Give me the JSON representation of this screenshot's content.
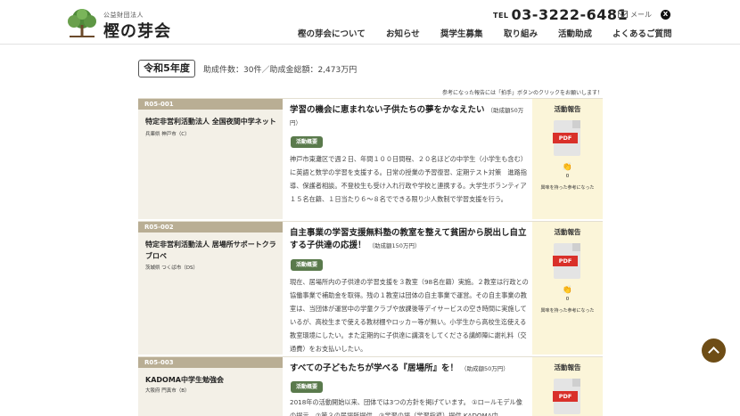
{
  "header": {
    "logo_sub": "公益財団法人",
    "logo_main": "樫の芽会",
    "tel_label": "TEL",
    "tel_number": "03-3222-6481",
    "mail_label": "メール",
    "x_label": "X"
  },
  "nav": [
    {
      "label": "樫の芽会について"
    },
    {
      "label": "お知らせ"
    },
    {
      "label": "奨学生募集"
    },
    {
      "label": "取り組み"
    },
    {
      "label": "活動助成"
    },
    {
      "label": "よくあるご質問"
    }
  ],
  "year": {
    "label": "令和5年度",
    "summary": "助成件数：30件／助成金総額：2,473万円"
  },
  "notice": "参考になった報告には「拍手」ボタンのクリックをお願いします！",
  "rows": [
    {
      "code": "R05-001",
      "org": "特定非営利活動法人 全国夜間中学ネット",
      "location": "兵庫県 神戸市（C）",
      "title": "学習の機会に恵まれない子供たちの夢をかなえたい",
      "amount": "（助成額50万円）",
      "badge": "活動概要",
      "description": "神戸市東灘区で週２日、年間１００日間程、２０名ほどの中学生（小学生も含む）に英語と数学の学習を支援する。日常の授業の予習復習、定期テスト対策　進路指導、保護者相談。不登校生も受け入れ行政や学校と連携する。大学生ボランティア１５名在籍、１日当たり６～８名でできる限り少人数制で学習支援を行う。",
      "report_label": "活動報告",
      "pdf": "PDF",
      "applause": "0",
      "help": "興味を持った参考になった"
    },
    {
      "code": "R05-002",
      "org": "特定非営利活動法人 居場所サポートクラブロペ",
      "location": "茨城県 つくば市（DS）",
      "title": "自主事業の学習支援無料塾の教室を整えて貧困から脱出し自立する子供達の応援！",
      "amount": "（助成額150万円）",
      "badge": "活動概要",
      "description": "現在、居場所内の子供達の学習支援を３教室（98名在籍）実施。２教室は行政との協働事業で補助金を取得。残の１教室は団体の自主事業で運営。その自主事業の教室は、当団体が運営中の学童クラブや放課後等デイサービスの空き時間に実施しているが、高校生まで使える教材棚やロッカー等が無い。小学生から高校生迄使える教室環境にしたい。また定期的に子供達に講演をしてくださる講師陣に謝礼料（交通費）をお支払いしたい。",
      "report_label": "活動報告",
      "pdf": "PDF",
      "applause": "0",
      "help": "興味を持った参考になった"
    },
    {
      "code": "R05-003",
      "org": "KADOMA中学生勉強会",
      "location": "大阪府 門真市（B）",
      "title": "すべての子どもたちが学べる『居場所』を！",
      "amount": "（助成額50万円）",
      "badge": "活動概要",
      "description": "2018年の活動開始以来、団体では3つの方針を掲げています。 ①ロールモデル像の提示、②第３の居場所提供、③学習の場（学習指導）提供 KADOMA中",
      "report_label": "活動報告",
      "pdf": "PDF",
      "applause": "0",
      "help": "興味を持った参考になった"
    }
  ],
  "colors": {
    "code_bar": "#b9ae94",
    "org_bg": "#f3f0e7",
    "report_bg": "#fbf5d9",
    "badge": "#5a7a4c",
    "pdf_tag": "#d9302a",
    "scroll_top": "#6e4d16"
  }
}
